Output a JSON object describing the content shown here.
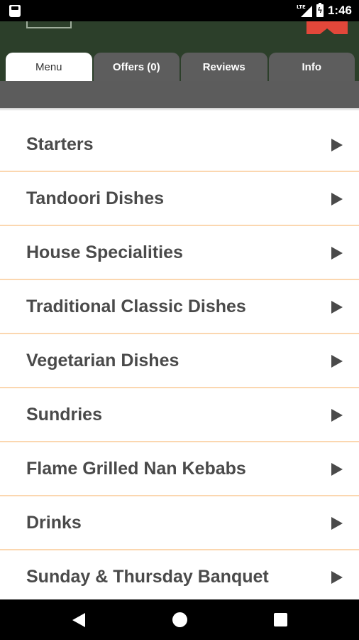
{
  "status_bar": {
    "time": "1:46",
    "network": "LTE"
  },
  "tabs": [
    {
      "label": "Menu",
      "active": true
    },
    {
      "label": "Offers (0)",
      "active": false
    },
    {
      "label": "Reviews",
      "active": false
    },
    {
      "label": "Info",
      "active": false
    }
  ],
  "menu": {
    "items": [
      {
        "label": "Starters"
      },
      {
        "label": "Tandoori Dishes"
      },
      {
        "label": "House Specialities"
      },
      {
        "label": "Traditional Classic Dishes"
      },
      {
        "label": "Vegetarian Dishes"
      },
      {
        "label": "Sundries"
      },
      {
        "label": "Flame Grilled Nan Kebabs"
      },
      {
        "label": "Drinks"
      },
      {
        "label": "Sunday & Thursday Banquet"
      }
    ]
  },
  "colors": {
    "header_bg": "#2c3f2a",
    "tab_bg": "#5d5d5d",
    "divider": "#fbd7b0",
    "ribbon": "#e2473a",
    "text": "#4a4a4a"
  }
}
